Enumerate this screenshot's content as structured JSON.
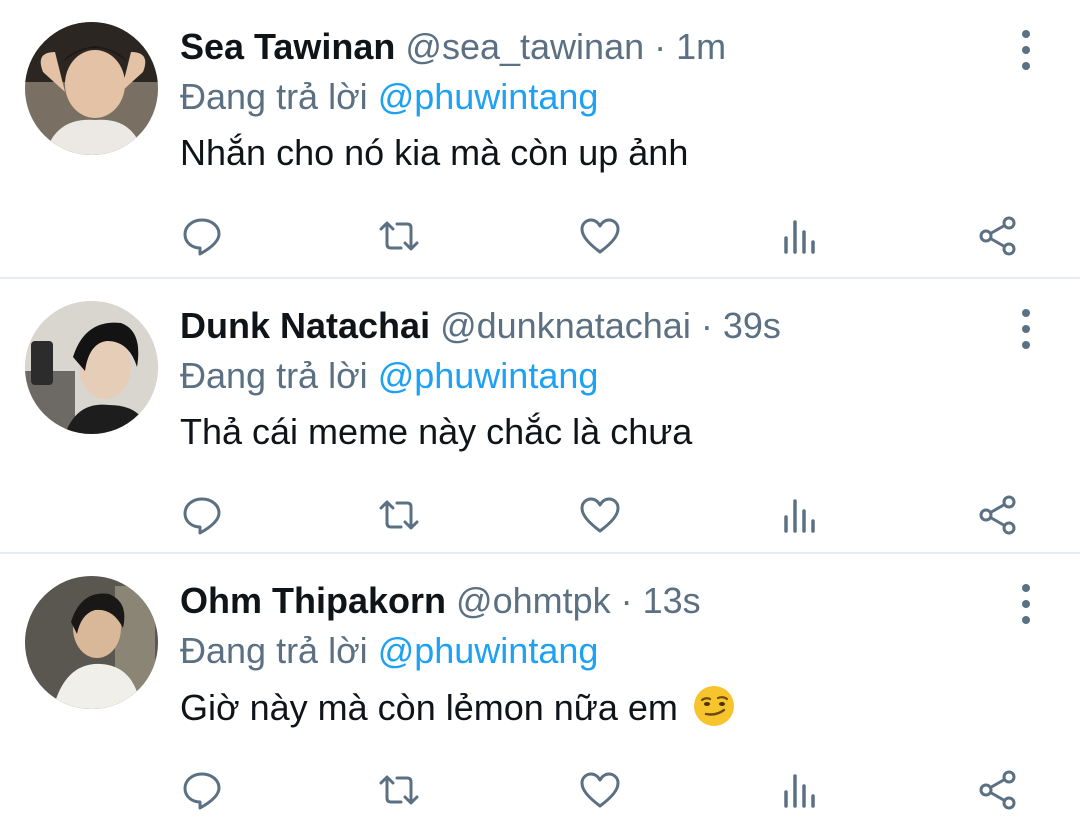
{
  "tweets": [
    {
      "name": "Sea Tawinan",
      "handle": "@sea_tawinan",
      "separator": " · ",
      "time": "1m",
      "reply_prefix": "Đang trả lời ",
      "reply_to": "@phuwintang",
      "text": "Nhắn cho nó kia mà còn up ảnh",
      "avatar_color": "#8a7a6c"
    },
    {
      "name": "Dunk Natachai",
      "handle": "@dunknatachai",
      "separator": " · ",
      "time": "39s",
      "reply_prefix": "Đang trả lời ",
      "reply_to": "@phuwintang",
      "text": "Thả cái meme này chắc là chưa",
      "avatar_color": "#3b3a3a"
    },
    {
      "name": "Ohm Thipakorn",
      "handle": "@ohmtpk",
      "separator": " · ",
      "time": "13s",
      "reply_prefix": "Đang trả lời ",
      "reply_to": "@phuwintang",
      "text": "Giờ này mà còn lẻmon nữa em",
      "emoji": "smirking-face",
      "avatar_color": "#6b6a62"
    }
  ],
  "icons": {
    "reply": "reply-icon",
    "retweet": "retweet-icon",
    "like": "heart-icon",
    "stats": "analytics-icon",
    "share": "share-icon",
    "more": "more-vertical-icon"
  },
  "colors": {
    "name": "#0f1419",
    "secondary": "#5b7083",
    "mention": "#1da1f2",
    "divider": "#e6ecf0"
  }
}
